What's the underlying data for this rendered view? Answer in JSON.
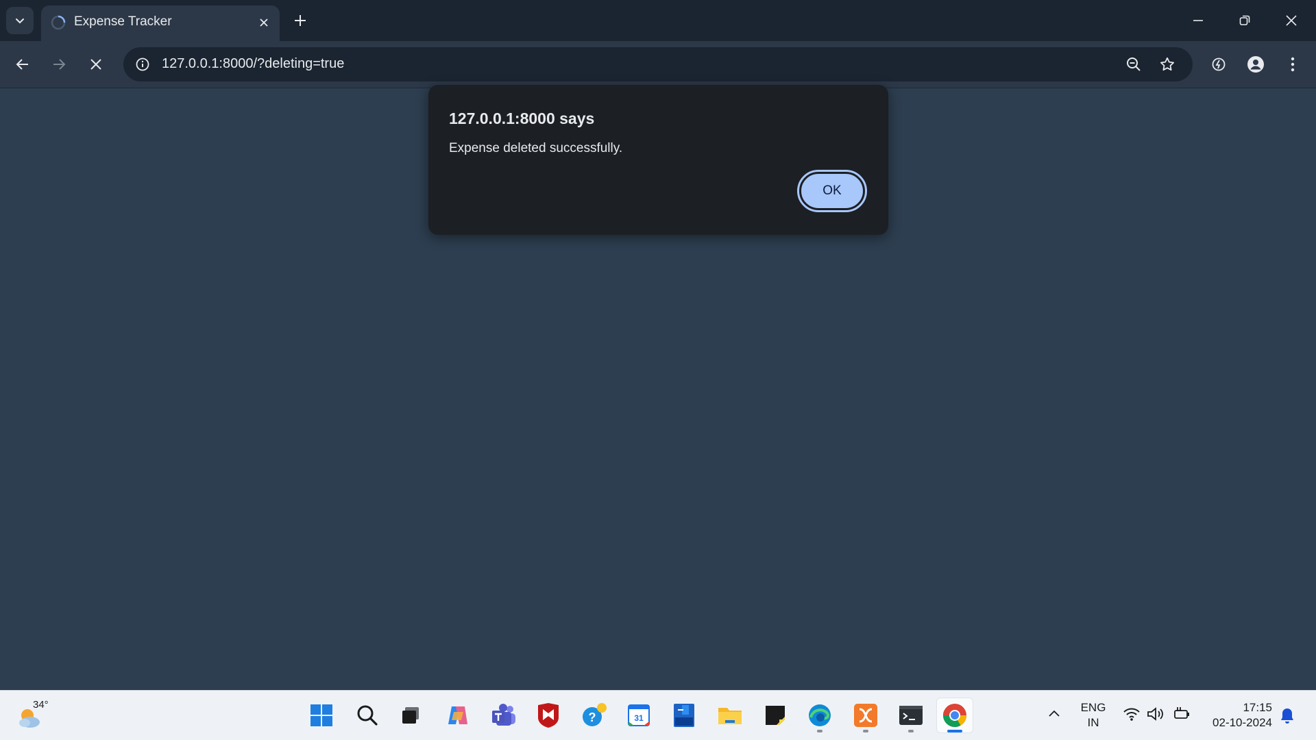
{
  "browser": {
    "tab": {
      "title": "Expense Tracker",
      "loading": true
    },
    "address": {
      "url": "127.0.0.1:8000/?deleting=true"
    }
  },
  "dialog": {
    "title": "127.0.0.1:8000 says",
    "message": "Expense deleted successfully.",
    "ok_label": "OK"
  },
  "taskbar": {
    "weather_temp": "34°",
    "apps": [
      "start-icon",
      "search-icon",
      "task-view-icon",
      "copilot-icon",
      "teams-icon",
      "mcafee-icon",
      "tips-icon",
      "calendar-icon",
      "word-app-icon",
      "file-explorer-icon",
      "sticky-notes-icon",
      "edge-icon",
      "xampp-icon",
      "terminal-icon",
      "chrome-icon"
    ],
    "language": {
      "line1": "ENG",
      "line2": "IN"
    },
    "clock": {
      "time": "17:15",
      "date": "02-10-2024"
    }
  },
  "colors": {
    "page_background": "#2d3e50",
    "dialog_background": "#1c1f24",
    "ok_button": "#a8c7fa",
    "taskbar": "#eef2f6"
  }
}
